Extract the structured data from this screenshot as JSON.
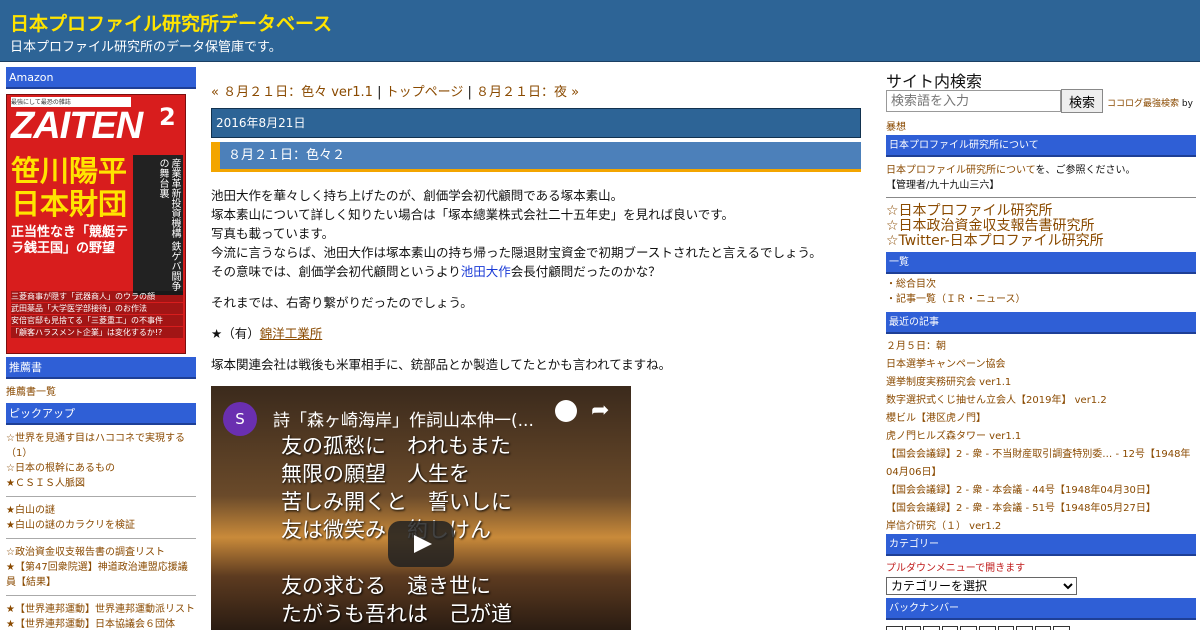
{
  "header": {
    "title": "日本プロファイル研究所データベース",
    "description": "日本プロファイル研究所のデータ保管庫です。"
  },
  "left": {
    "amazon_heading": "Amazon",
    "magazine": {
      "top_text": "最強にして最恐の雑誌",
      "title": "ZAITEN",
      "issue": "2",
      "headline": "笹川陽平 日本財団",
      "subhead": "正当性なき「競艇テラ銭王国」の野望",
      "side": "産業革新投資機構 鉄ゲバ闘争の舞台裏",
      "lines": [
        "三菱商事が隠す「武器商人」のウラの顔",
        "武田薬品「大学医学部接待」のお作法",
        "安倍官邸も見捨てる「三菱重工」の不事件",
        "「顧客ハラスメント企業」は変化するか!?"
      ]
    },
    "recommended_heading": "推薦書",
    "recommended_link": "推薦書一覧",
    "pickup_heading": "ピックアップ",
    "pickup_groups": [
      [
        "☆世界を見通す目はハココネで実現する（1）",
        "☆日本の根幹にあるもの",
        "★ＣＳＩＳ人脈図"
      ],
      [
        "★白山の謎",
        "★白山の謎のカラクリを検証"
      ],
      [
        "☆政治資金収支報告書の調査リスト",
        "★【第47回衆院選】神道政治連盟応援議員【結果】"
      ],
      [
        "★【世界連邦運動】世界連邦運動派リスト",
        "★【世界連邦運動】日本協議会６団体"
      ]
    ]
  },
  "main": {
    "nav": {
      "prev": "« ８月２１日：色々 ver1.1",
      "sep": "|",
      "top": "トップページ",
      "next": "８月２１日：夜 »"
    },
    "date": "2016年8月21日",
    "post_title": "８月２１日：色々２",
    "paragraph1": [
      "池田大作を華々しく持ち上げたのが、創価学会初代顧問である塚本素山。",
      "塚本素山について詳しく知りたい場合は「塚本總業株式会社二十五年史」を見れば良いです。",
      "写真も載っています。",
      "今流に言うならば、池田大作は塚本素山の持ち帰った隠退財宝資金で初期ブーストされたと言えるでしょう。"
    ],
    "paragraph1_last_before": "その意味では、創価学会初代顧問というより",
    "paragraph1_last_link": "池田大作",
    "paragraph1_last_after": "会長付顧問だったのかな？",
    "paragraph2": "それまでは、右寄り繋がりだったのでしょう。",
    "paragraph3_prefix": "★（有）",
    "paragraph3_link": "錦洋工業所",
    "paragraph4": "塚本関連会社は戦後も米軍相手に、銃部品とか製造してたとかも言われてますね。",
    "video": {
      "channel_initial": "S",
      "title": "詩「森ヶ崎海岸」作詞山本伸一(...",
      "lyrics": "友の孤愁に　われもまた\n無限の願望　人生を\n苦しみ開くと　誓いしに\n友は微笑み　約しけん\n\n友の求むる　遠き世に\nたがうも吾れは　己が道\n長歌の舞台　涯しなく"
    }
  },
  "right": {
    "search_title": "サイト内検索",
    "search_placeholder": "検索語を入力",
    "search_button": "検索",
    "search_credit_link": "ココログ最強検索",
    "search_credit_by": "by",
    "search_author": "暴想",
    "about_heading": "日本プロファイル研究所について",
    "about_link": "日本プロファイル研究所について",
    "about_text": "を、ご参照ください。",
    "about_admin": "【管理者/九十九山三六】",
    "profile_links": [
      "☆日本プロファイル研究所",
      "☆日本政治資金収支報告書研究所",
      "☆Twitter-日本プロファイル研究所"
    ],
    "index_heading": "一覧",
    "index_links": [
      "総合目次",
      "記事一覧（ＩＲ・ニュース）"
    ],
    "recent_heading": "最近の記事",
    "recent_posts": [
      "２月５日：朝",
      "日本選挙キャンペーン協会",
      "選挙制度実務研究会 ver1.1",
      "数字選択式くじ抽せん立会人【2019年】 ver1.2",
      "櫻ビル【港区虎ノ門】",
      "虎ノ門ヒルズ森タワー ver1.1",
      "【国会会議録】2 - 衆 - 不当財産取引調査特別委… - 12号【1948年04月06日】",
      "【国会会議録】2 - 衆 - 本会議 - 44号【1948年04月30日】",
      "【国会会議録】2 - 衆 - 本会議 - 51号【1948年05月27日】",
      "岸信介研究（１） ver1.2"
    ],
    "category_heading": "カテゴリー",
    "category_note": "プルダウンメニューで開きます",
    "category_select": "カテゴリーを選択",
    "backnumber_heading": "バックナンバー"
  }
}
